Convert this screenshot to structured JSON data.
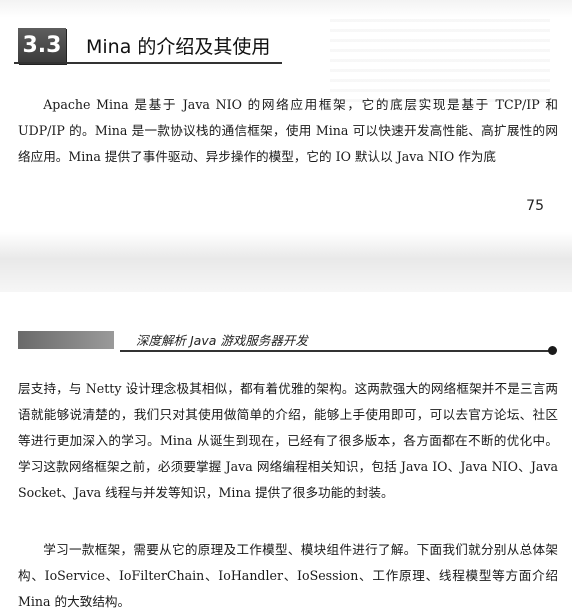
{
  "top_page": {
    "section_number": "3.3",
    "section_title": "Mina 的介绍及其使用",
    "paragraph": "Apache Mina 是基于 Java NIO 的网络应用框架，它的底层实现是基于 TCP/IP 和 UDP/IP 的。Mina 是一款协议栈的通信框架，使用 Mina 可以快速开发高性能、高扩展性的网络应用。Mina 提供了事件驱动、异步操作的模型，它的 IO 默认以 Java NIO 作为底",
    "page_number": "75"
  },
  "bottom_page": {
    "running_header": "深度解析 Java 游戏服务器开发",
    "paragraph_1": "层支持，与 Netty 设计理念极其相似，都有着优雅的架构。这两款强大的网络框架并不是三言两语就能够说清楚的，我们只对其使用做简单的介绍，能够上手使用即可，可以去官方论坛、社区等进行更加深入的学习。Mina 从诞生到现在，已经有了很多版本，各方面都在不断的优化中。学习这款网络框架之前，必须要掌握 Java 网络编程相关知识，包括 Java IO、Java NIO、Java Socket、Java 线程与并发等知识，Mina 提供了很多功能的封装。",
    "paragraph_2": "学习一款框架，需要从它的原理及工作模型、模块组件进行了解。下面我们就分别从总体架构、IoService、IoFilterChain、IoHandler、IoSession、工作原理、线程模型等方面介绍 Mina 的大致结构。"
  }
}
